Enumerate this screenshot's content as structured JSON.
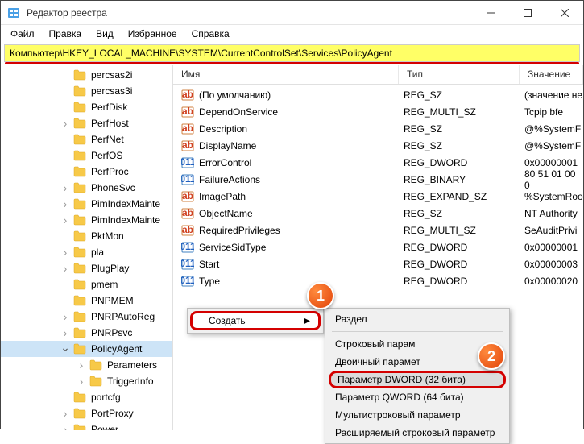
{
  "window": {
    "title": "Редактор реестра"
  },
  "menu": [
    "Файл",
    "Правка",
    "Вид",
    "Избранное",
    "Справка"
  ],
  "address": "Компьютер\\HKEY_LOCAL_MACHINE\\SYSTEM\\CurrentControlSet\\Services\\PolicyAgent",
  "tree": [
    {
      "label": "percsas2i",
      "indent": 74,
      "chev": ""
    },
    {
      "label": "percsas3i",
      "indent": 74,
      "chev": ""
    },
    {
      "label": "PerfDisk",
      "indent": 74,
      "chev": ""
    },
    {
      "label": "PerfHost",
      "indent": 74,
      "chev": ">"
    },
    {
      "label": "PerfNet",
      "indent": 74,
      "chev": ""
    },
    {
      "label": "PerfOS",
      "indent": 74,
      "chev": ""
    },
    {
      "label": "PerfProc",
      "indent": 74,
      "chev": ""
    },
    {
      "label": "PhoneSvc",
      "indent": 74,
      "chev": ">"
    },
    {
      "label": "PimIndexMainte",
      "indent": 74,
      "chev": ">"
    },
    {
      "label": "PimIndexMainte",
      "indent": 74,
      "chev": ">"
    },
    {
      "label": "PktMon",
      "indent": 74,
      "chev": ""
    },
    {
      "label": "pla",
      "indent": 74,
      "chev": ">"
    },
    {
      "label": "PlugPlay",
      "indent": 74,
      "chev": ">"
    },
    {
      "label": "pmem",
      "indent": 74,
      "chev": ""
    },
    {
      "label": "PNPMEM",
      "indent": 74,
      "chev": ""
    },
    {
      "label": "PNRPAutoReg",
      "indent": 74,
      "chev": ">"
    },
    {
      "label": "PNRPsvc",
      "indent": 74,
      "chev": ">"
    },
    {
      "label": "PolicyAgent",
      "indent": 74,
      "chev": "v",
      "selected": true
    },
    {
      "label": "Parameters",
      "indent": 94,
      "chev": ">"
    },
    {
      "label": "TriggerInfo",
      "indent": 94,
      "chev": ">"
    },
    {
      "label": "portcfg",
      "indent": 74,
      "chev": ""
    },
    {
      "label": "PortProxy",
      "indent": 74,
      "chev": ">"
    },
    {
      "label": "Power",
      "indent": 74,
      "chev": ">"
    }
  ],
  "columns": {
    "name": "Имя",
    "type": "Тип",
    "value": "Значение"
  },
  "rows": [
    {
      "icon": "str",
      "name": "(По умолчанию)",
      "type": "REG_SZ",
      "value": "(значение не"
    },
    {
      "icon": "str",
      "name": "DependOnService",
      "type": "REG_MULTI_SZ",
      "value": "Tcpip bfe"
    },
    {
      "icon": "str",
      "name": "Description",
      "type": "REG_SZ",
      "value": "@%SystemF"
    },
    {
      "icon": "str",
      "name": "DisplayName",
      "type": "REG_SZ",
      "value": "@%SystemF"
    },
    {
      "icon": "num",
      "name": "ErrorControl",
      "type": "REG_DWORD",
      "value": "0x00000001"
    },
    {
      "icon": "num",
      "name": "FailureActions",
      "type": "REG_BINARY",
      "value": "80 51 01 00 0"
    },
    {
      "icon": "str",
      "name": "ImagePath",
      "type": "REG_EXPAND_SZ",
      "value": "%SystemRoo"
    },
    {
      "icon": "str",
      "name": "ObjectName",
      "type": "REG_SZ",
      "value": "NT Authority"
    },
    {
      "icon": "str",
      "name": "RequiredPrivileges",
      "type": "REG_MULTI_SZ",
      "value": "SeAuditPrivi"
    },
    {
      "icon": "num",
      "name": "ServiceSidType",
      "type": "REG_DWORD",
      "value": "0x00000001"
    },
    {
      "icon": "num",
      "name": "Start",
      "type": "REG_DWORD",
      "value": "0x00000003"
    },
    {
      "icon": "num",
      "name": "Type",
      "type": "REG_DWORD",
      "value": "0x00000020"
    }
  ],
  "ctx1": {
    "create": "Создать"
  },
  "ctx2": {
    "section": "Раздел",
    "string": "Строковый парам",
    "binary": "Двоичный парамет",
    "dword": "Параметр DWORD (32 бита)",
    "qword": "Параметр QWORD (64 бита)",
    "multistring": "Мультистроковый параметр",
    "expstring": "Расширяемый строковый параметр"
  },
  "badges": {
    "one": "1",
    "two": "2"
  }
}
